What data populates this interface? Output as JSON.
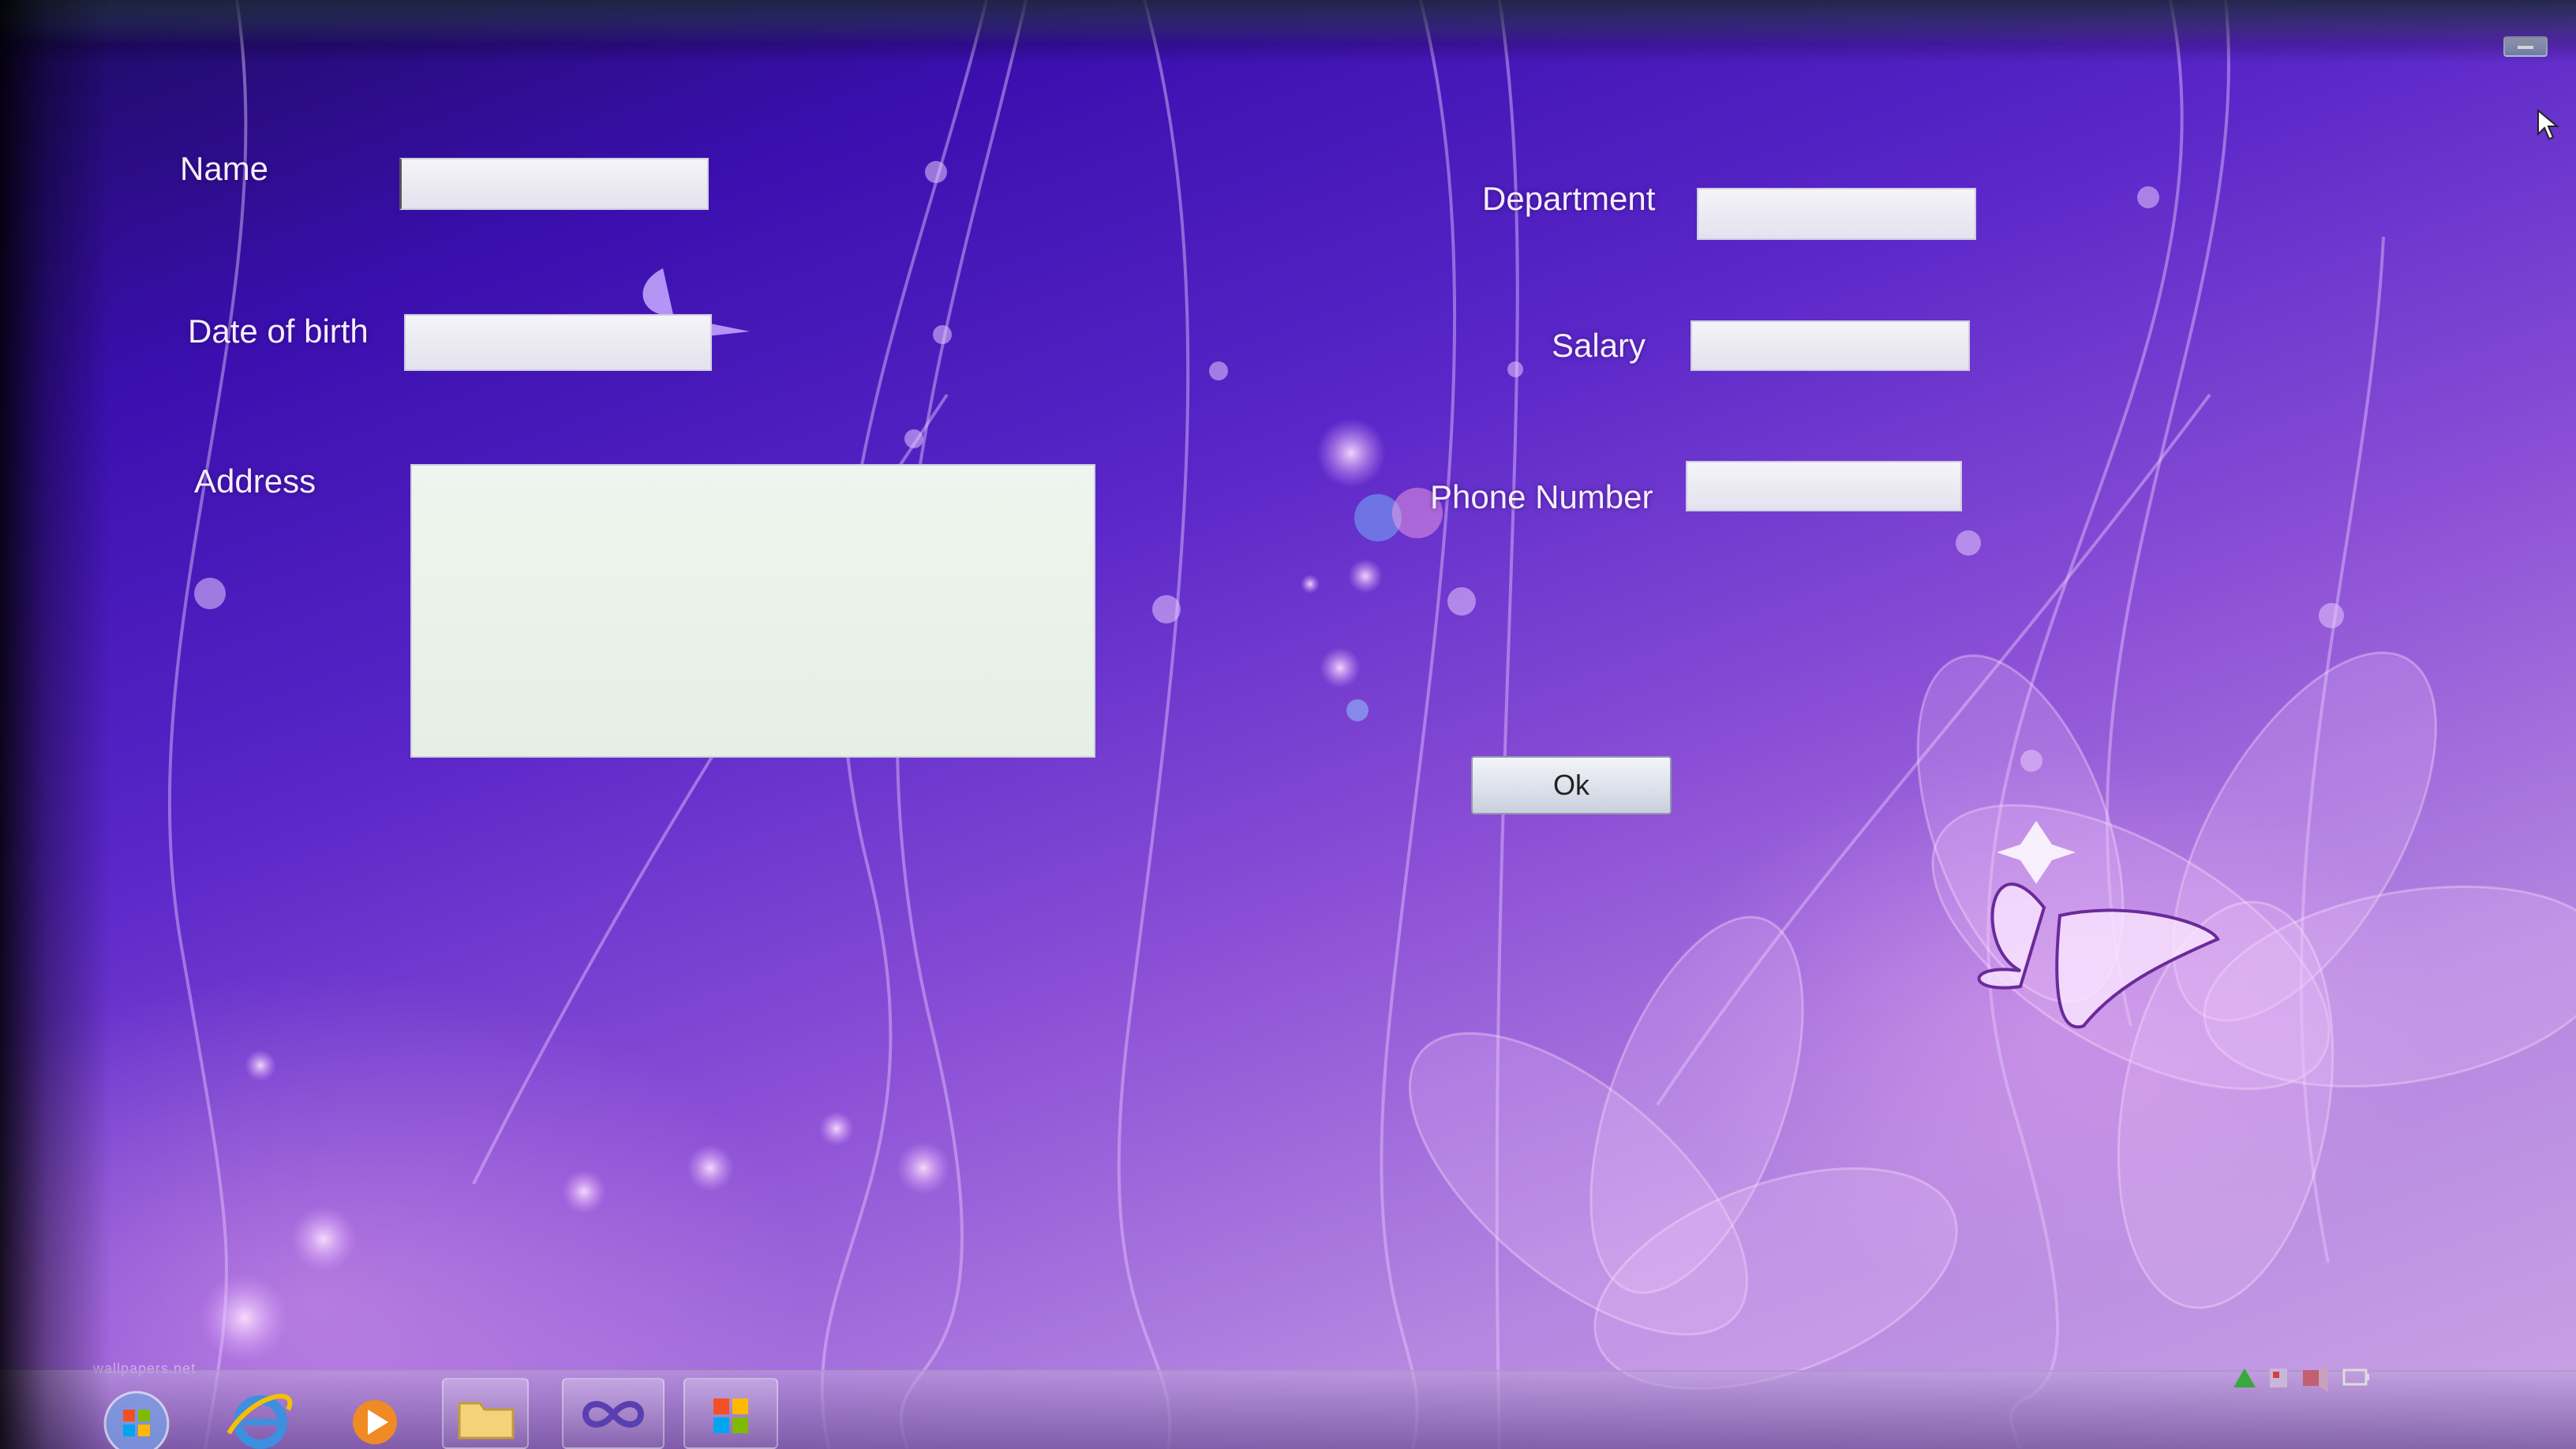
{
  "form": {
    "name_label": "Name",
    "dob_label": "Date of birth",
    "address_label": "Address",
    "department_label": "Department",
    "salary_label": "Salary",
    "phone_label": "Phone Number",
    "ok_label": "Ok",
    "name_value": "",
    "dob_value": "",
    "address_value": "",
    "department_value": "",
    "salary_value": "",
    "phone_value": ""
  },
  "colors": {
    "background_top": "#2a0c8a",
    "background_bottom": "#c9a4e6",
    "label_text": "#f4eefe",
    "field_background": "#eeeef4"
  },
  "taskbar": {
    "items": [
      {
        "name": "windows-start-orb",
        "icon": "start-orb-icon"
      },
      {
        "name": "internet-explorer",
        "icon": "internet-explorer-icon"
      },
      {
        "name": "media-player",
        "icon": "media-player-icon"
      },
      {
        "name": "file-explorer",
        "icon": "folder-icon"
      },
      {
        "name": "visual-studio",
        "icon": "infinity-icon"
      },
      {
        "name": "application-window",
        "icon": "windows-flag-icon"
      }
    ],
    "tray_icons": [
      "network-icon",
      "flag-icon",
      "volume-icon",
      "battery-icon"
    ]
  },
  "decor": {
    "watermark": "wallpapers.net"
  }
}
